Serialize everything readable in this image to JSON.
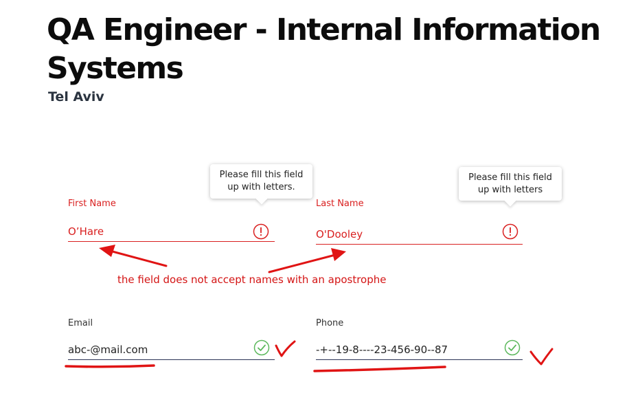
{
  "job": {
    "title": "QA Engineer - Internal Information Systems",
    "location": "Tel Aviv"
  },
  "form": {
    "first_name": {
      "label": "First Name",
      "value": "O’Hare",
      "status": "error",
      "status_icon": "exclamation-circle-icon",
      "tooltip": "Please fill this field up with letters."
    },
    "last_name": {
      "label": "Last Name",
      "value": "O'Dooley",
      "status": "error",
      "status_icon": "exclamation-circle-icon",
      "tooltip": "Please fill this field up with letters"
    },
    "email": {
      "label": "Email",
      "value": "abc-@mail.com",
      "status": "valid",
      "status_icon": "check-circle-icon"
    },
    "phone": {
      "label": "Phone",
      "value": "-+--19-8----23-456-90--87",
      "status": "valid",
      "status_icon": "check-circle-icon"
    }
  },
  "annotations": {
    "note": "the field does not accept names with an apostrophe",
    "color": "#e01414"
  },
  "colors": {
    "error": "#d91f1f",
    "valid": "#5cb85c",
    "underline": "#2a3255",
    "title": "#0c0c0c"
  }
}
